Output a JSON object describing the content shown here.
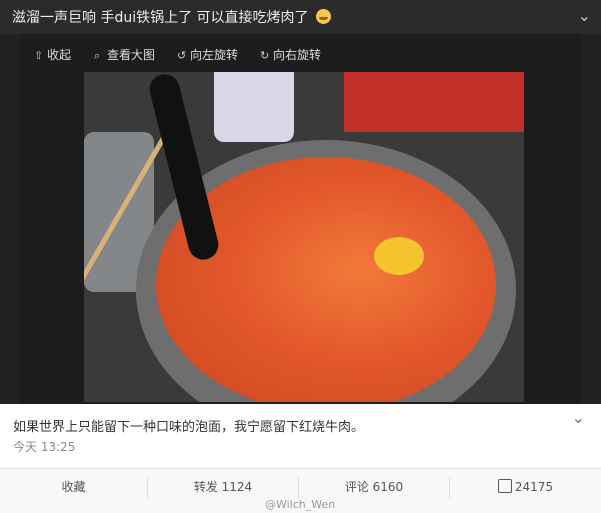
{
  "post": {
    "text": "滋溜一声巨响 手dui铁锅上了 可以直接吃烤肉了",
    "emoji": "laughing-face-emoji"
  },
  "toolbar": {
    "collapse": "收起",
    "view_large": "查看大图",
    "rotate_left": "向左旋转",
    "rotate_right": "向右旋转"
  },
  "image": {
    "description": "kimchi stew with egg in a stone bowl",
    "watermark": "@Wilch_Wen"
  },
  "card": {
    "caption": "如果世界上只能留下一种口味的泡面，我宁愿留下红烧牛肉。",
    "time": "今天 13:25"
  },
  "actions": {
    "favorite": "收藏",
    "repost": "转发 1124",
    "comment": "评论 6160",
    "like": "24175"
  },
  "colors": {
    "dark_bg": "#222222",
    "card_bg": "#ffffff",
    "text": "#333333"
  }
}
